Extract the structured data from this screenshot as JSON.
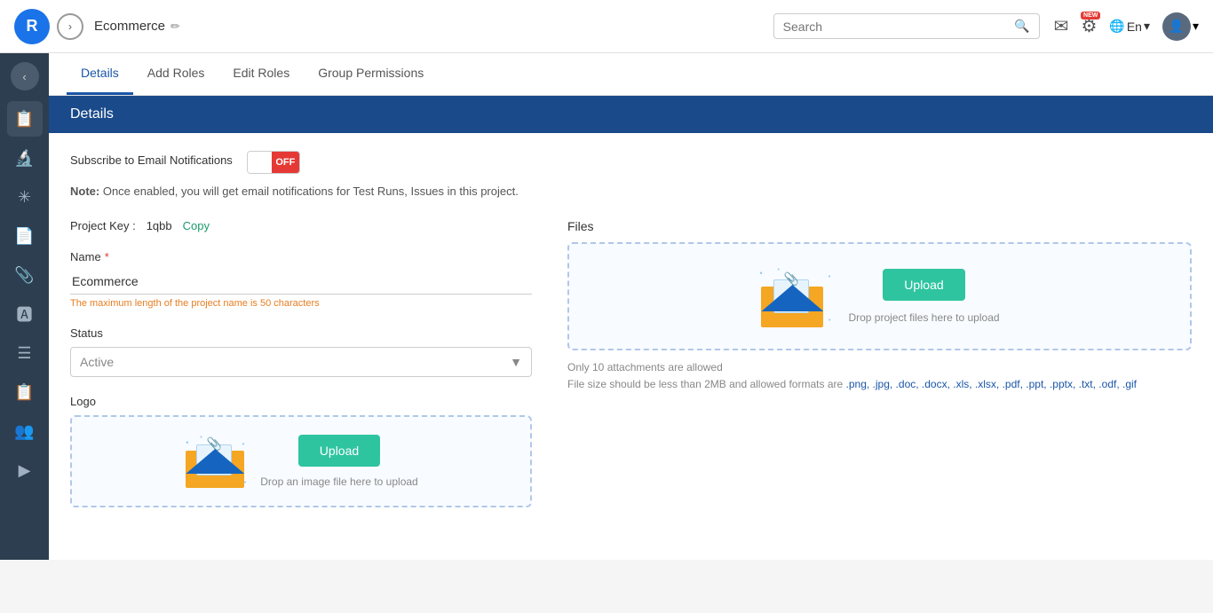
{
  "topNav": {
    "logo": "R",
    "forwardBtn": "›",
    "title": "Ecommerce",
    "editIconLabel": "✏",
    "search": {
      "placeholder": "Search"
    },
    "mailIcon": "✉",
    "updateIcon": "⚙",
    "updateBadge": "NEW",
    "langIcon": "🌐",
    "lang": "En",
    "userIcon": "👤"
  },
  "sidebar": {
    "collapseIcon": "‹",
    "items": [
      {
        "icon": "📋",
        "label": "tasks"
      },
      {
        "icon": "🔬",
        "label": "explore"
      },
      {
        "icon": "✳",
        "label": "asterisk"
      },
      {
        "icon": "📄",
        "label": "document"
      },
      {
        "icon": "📎",
        "label": "paperclip"
      },
      {
        "icon": "🅰",
        "label": "text"
      },
      {
        "icon": "☰",
        "label": "menu"
      },
      {
        "icon": "📋",
        "label": "copy"
      },
      {
        "icon": "👥",
        "label": "users"
      },
      {
        "icon": "▶",
        "label": "play"
      }
    ]
  },
  "tabs": [
    {
      "label": "Details",
      "active": true
    },
    {
      "label": "Add Roles",
      "active": false
    },
    {
      "label": "Edit Roles",
      "active": false
    },
    {
      "label": "Group Permissions",
      "active": false
    }
  ],
  "sectionHeader": {
    "title": "Details"
  },
  "emailNotif": {
    "label": "Subscribe to Email Notifications",
    "toggleState": "OFF",
    "note": "Note:",
    "noteText": "Once enabled, you will get email notifications for Test Runs, Issues in this project."
  },
  "form": {
    "projectKey": {
      "label": "Project Key :",
      "value": "1qbb",
      "copyLabel": "Copy"
    },
    "name": {
      "label": "Name",
      "required": true,
      "value": "Ecommerce",
      "hint": "The maximum length of the project name is 50 characters"
    },
    "status": {
      "label": "Status",
      "value": "Active",
      "dropdownIcon": "▼"
    },
    "logo": {
      "label": "Logo",
      "uploadBtn": "Upload",
      "hint": "Drop an image file here to upload"
    }
  },
  "files": {
    "label": "Files",
    "uploadBtn": "Upload",
    "hint": "Drop project files here to upload",
    "attachmentLimit": "Only 10 attachments are allowed",
    "sizeLimit": "File size should be less than 2MB and allowed formats are",
    "formats": ".png, .jpg, .doc, .docx, .xls, .xlsx, .pdf, .ppt, .pptx, .txt, .odf, .gif"
  }
}
